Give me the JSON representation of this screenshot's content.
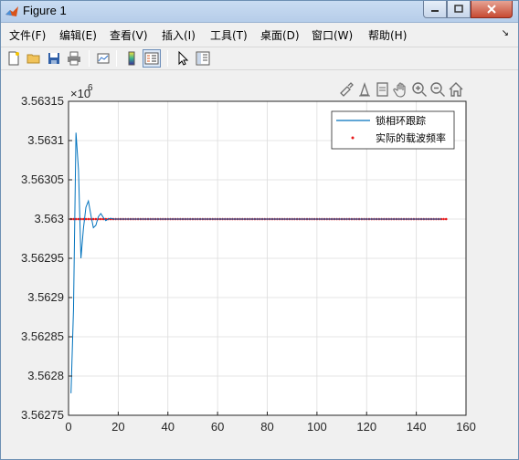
{
  "window": {
    "title": "Figure 1"
  },
  "menu": {
    "items": [
      "文件(F)",
      "编辑(E)",
      "查看(V)",
      "插入(I)",
      "工具(T)",
      "桌面(D)",
      "窗口(W)",
      "帮助(H)"
    ]
  },
  "toolbar": {
    "buttons": [
      "new-figure-icon",
      "open-folder-icon",
      "save-icon",
      "print-icon",
      "link-plot-icon",
      "colorbar-icon",
      "legend-icon",
      "pointer-icon",
      "property-editor-icon"
    ]
  },
  "axes_toolbar": {
    "buttons": [
      "brush-icon",
      "datatip-icon",
      "rotate-icon",
      "pan-icon",
      "zoom-in-icon",
      "zoom-out-icon",
      "home-icon"
    ]
  },
  "colors": {
    "series_line": "#0072bd",
    "series_dots": "#e8191b",
    "grid": "#dcdcdc"
  },
  "chart_data": {
    "type": "line",
    "title": "",
    "xlabel": "",
    "ylabel": "",
    "exponent_label": "×10",
    "exponent_power": "6",
    "xlim": [
      0,
      160
    ],
    "ylim": [
      3.56275,
      3.56315
    ],
    "x_ticks": [
      0,
      20,
      40,
      60,
      80,
      100,
      120,
      140,
      160
    ],
    "y_ticks": [
      "3.56275",
      "3.5628",
      "3.56285",
      "3.5629",
      "3.56295",
      "3.563",
      "3.56305",
      "3.5631",
      "3.56315"
    ],
    "grid": true,
    "legend_position": "top-right",
    "series": [
      {
        "name": "锁相环跟踪",
        "style": "line",
        "x": [
          1,
          2,
          3,
          4,
          5,
          6,
          7,
          8,
          9,
          10,
          11,
          12,
          13,
          14,
          15,
          16,
          17,
          18,
          19,
          20,
          25,
          30,
          40,
          50,
          60,
          80,
          100,
          120,
          140,
          150
        ],
        "y": [
          3.562778,
          3.562885,
          3.56311,
          3.563063,
          3.56295,
          3.562988,
          3.563015,
          3.563023,
          3.563005,
          3.562989,
          3.562992,
          3.563003,
          3.563007,
          3.563002,
          3.562998,
          3.563,
          3.563001,
          3.563,
          3.563,
          3.563,
          3.563,
          3.563,
          3.563,
          3.563,
          3.563,
          3.563,
          3.563,
          3.563,
          3.563,
          3.563
        ]
      },
      {
        "name": "实际的载波频率",
        "style": "dots",
        "x_start": 1,
        "x_end": 152,
        "value": 3.563
      }
    ]
  }
}
